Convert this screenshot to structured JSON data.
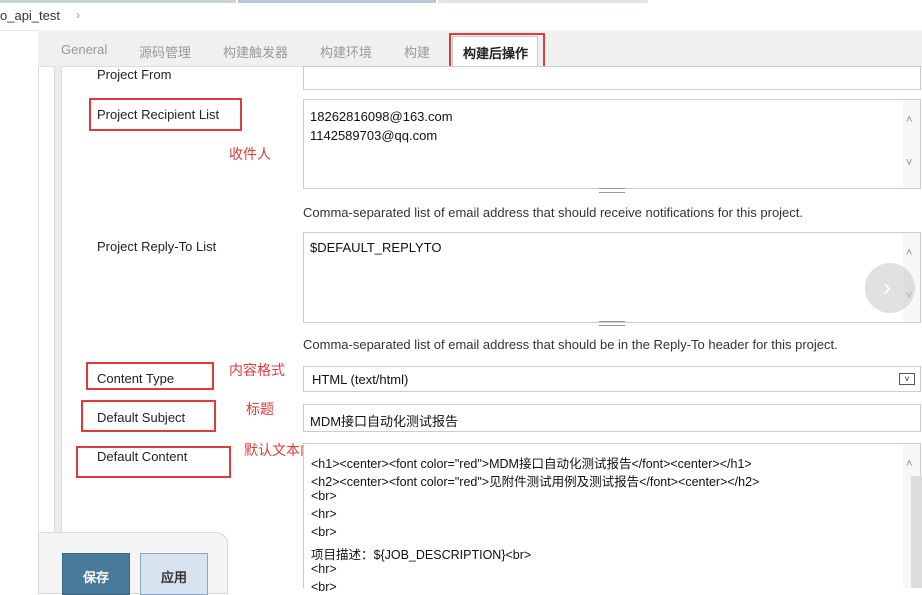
{
  "breadcrumb": {
    "job_name": "o_api_test",
    "arrow": "›"
  },
  "tabs": [
    {
      "label": "General"
    },
    {
      "label": "源码管理"
    },
    {
      "label": "构建触发器"
    },
    {
      "label": "构建环境"
    },
    {
      "label": "构建"
    },
    {
      "label": "构建后操作"
    }
  ],
  "form": {
    "project_from_label": "Project From",
    "recipient_label": "Project Recipient List",
    "recipients": [
      "18262816098@163.com",
      "1142589703@qq.com"
    ],
    "recipient_help": "Comma-separated list of email address that should receive notifications for this project.",
    "replyto_label": "Project Reply-To List",
    "replyto_value": "$DEFAULT_REPLYTO",
    "replyto_help": "Comma-separated list of email address that should be in the Reply-To header for this project.",
    "content_type_label": "Content Type",
    "content_type_value": "HTML (text/html)",
    "subject_label": "Default Subject",
    "subject_value": "MDM接口自动化测试报告",
    "content_label": "Default Content",
    "content_lines": [
      "<h1><center><font color=\"red\">MDM接口自动化测试报告</font><center></h1>",
      "<h2><center><font color=\"red\">见附件测试用例及测试报告</font><center></h2>",
      "<br>",
      "<hr>",
      "<br>",
      "项目描述：${JOB_DESCRIPTION}<br>",
      "<hr>",
      "<br>"
    ]
  },
  "annotations": {
    "recipient": "收件人",
    "content_type": "内容格式",
    "subject": "标题",
    "content": "默认文本内容"
  },
  "buttons": {
    "save": "保存",
    "apply": "应用"
  },
  "colors": {
    "annotation_red": "#e03a3a",
    "save_bg": "#4a7a99",
    "apply_bg": "#d7e4f0"
  }
}
